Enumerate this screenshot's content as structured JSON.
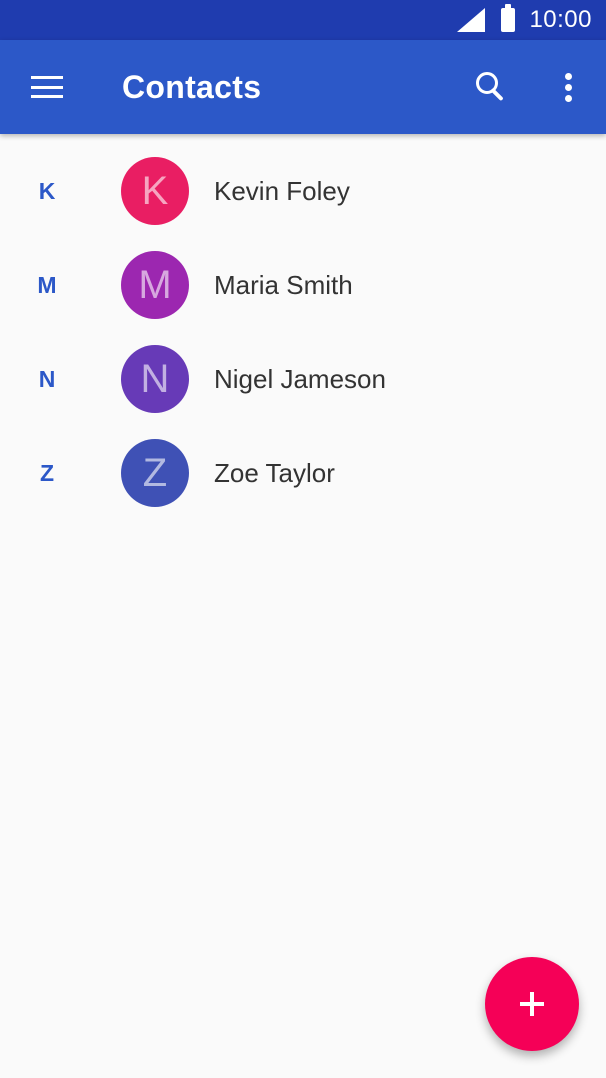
{
  "status_bar": {
    "time": "10:00",
    "icons": [
      "signal-icon",
      "battery-icon"
    ]
  },
  "app_bar": {
    "title": "Contacts",
    "icons": [
      "menu-icon",
      "search-icon",
      "overflow-icon"
    ]
  },
  "contacts": [
    {
      "section": "K",
      "initial": "K",
      "name": "Kevin Foley",
      "avatar_color": "#e91e63"
    },
    {
      "section": "M",
      "initial": "M",
      "name": "Maria Smith",
      "avatar_color": "#9c27b0"
    },
    {
      "section": "N",
      "initial": "N",
      "name": "Nigel Jameson",
      "avatar_color": "#673ab7"
    },
    {
      "section": "Z",
      "initial": "Z",
      "name": "Zoe Taylor",
      "avatar_color": "#3f51b5"
    }
  ],
  "fab": {
    "icon": "plus-icon"
  },
  "colors": {
    "status_bar": "#1f3caf",
    "app_bar": "#2c58c8",
    "accent": "#f50057",
    "section_letter": "#2c58c8",
    "background": "#fafafa"
  }
}
